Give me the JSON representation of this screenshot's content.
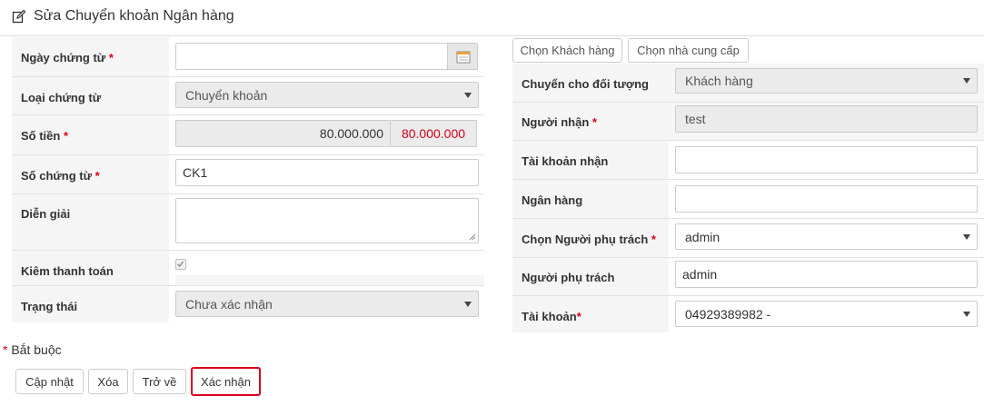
{
  "header": {
    "title": "Sửa Chuyển khoản Ngân hàng",
    "icon": "edit-icon"
  },
  "left": {
    "date": {
      "label": "Ngày chứng từ",
      "value": ""
    },
    "doc_type": {
      "label": "Loại chứng từ",
      "value": "Chuyển khoản"
    },
    "amount": {
      "label": "Số tiền",
      "value": "80.000.000",
      "converted": "80.000.000"
    },
    "doc_no": {
      "label": "Số chứng từ",
      "value": "CK1"
    },
    "description": {
      "label": "Diễn giải",
      "value": ""
    },
    "check_payment": {
      "label": "Kiêm thanh toán",
      "checked": true
    },
    "status": {
      "label": "Trạng thái",
      "value": "Chưa xác nhận"
    }
  },
  "right": {
    "choose_customer": "Chọn Khách hàng",
    "choose_supplier": "Chọn nhà cung cấp",
    "target": {
      "label": "Chuyển cho đối tượng",
      "value": "Khách hàng"
    },
    "receiver": {
      "label": "Người nhận",
      "value": "test"
    },
    "receive_account": {
      "label": "Tài khoản nhận",
      "value": ""
    },
    "bank": {
      "label": "Ngân hàng",
      "value": ""
    },
    "choose_staff": {
      "label": "Chọn Người phụ trách",
      "value": "admin"
    },
    "staff": {
      "label": "Người phụ trách",
      "value": "admin"
    },
    "account": {
      "label": "Tài khoản",
      "value": "04929389982 -"
    }
  },
  "footer": {
    "required_note": "Bắt buộc",
    "required_mark": "*",
    "buttons": {
      "update": "Cập nhật",
      "delete": "Xóa",
      "back": "Trở về",
      "confirm": "Xác nhận"
    }
  }
}
